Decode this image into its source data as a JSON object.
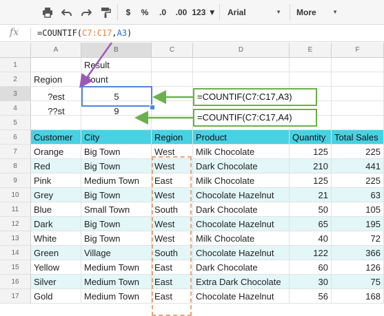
{
  "toolbar": {
    "currency_label": "$",
    "percent_label": "%",
    "dec_decrease_label": ".0",
    "dec_increase_label": ".00",
    "number_format_label": "123",
    "font_name": "Arial",
    "more_label": "More"
  },
  "formula_bar": {
    "fx_label": "fx",
    "prefix": "=COUNTIF(",
    "ref1": "C7:C17",
    "comma": ",",
    "ref2": "A3",
    "suffix": ")"
  },
  "columns": [
    "A",
    "B",
    "C",
    "D",
    "E",
    "F"
  ],
  "rows": [
    "1",
    "2",
    "3",
    "4",
    "5",
    "6",
    "7",
    "8",
    "9",
    "10",
    "11",
    "12",
    "13",
    "14",
    "15",
    "16",
    "17"
  ],
  "summary": {
    "result_label": "Result",
    "region_label": "Region",
    "count_label": "Count",
    "criteria": [
      {
        "pattern": "?est",
        "count": "5"
      },
      {
        "pattern": "??st",
        "count": "9"
      }
    ]
  },
  "callouts": [
    "=COUNTIF(C7:C17,A3)",
    "=COUNTIF(C7:C17,A4)"
  ],
  "table": {
    "headers": [
      "Customer",
      "City",
      "Region",
      "Product",
      "Quantity",
      "Total Sales"
    ],
    "rows": [
      [
        "Orange",
        "Big Town",
        "West",
        "Milk Chocolate",
        "125",
        "225"
      ],
      [
        "Red",
        "Big Town",
        "West",
        "Dark Chocolate",
        "210",
        "441"
      ],
      [
        "Pink",
        "Medium Town",
        "East",
        "Milk Chocolate",
        "125",
        "225"
      ],
      [
        "Grey",
        "Big Town",
        "West",
        "Chocolate Hazelnut",
        "21",
        "63"
      ],
      [
        "Blue",
        "Small Town",
        "South",
        "Dark Chocolate",
        "50",
        "105"
      ],
      [
        "Dark",
        "Big Town",
        "West",
        "Chocolate Hazelnut",
        "65",
        "195"
      ],
      [
        "White",
        "Big Town",
        "West",
        "Milk Chocolate",
        "40",
        "72"
      ],
      [
        "Green",
        "Village",
        "South",
        "Chocolate Hazelnut",
        "122",
        "366"
      ],
      [
        "Yellow",
        "Medium Town",
        "East",
        "Dark Chocolate",
        "60",
        "126"
      ],
      [
        "Silver",
        "Medium Town",
        "East",
        "Extra Dark Chocolate",
        "30",
        "75"
      ],
      [
        "Gold",
        "Medium Town",
        "East",
        "Chocolate Hazelnut",
        "56",
        "168"
      ]
    ]
  },
  "colors": {
    "header_fill": "#48d1e3",
    "stripe_fill": "#e3f6f8",
    "callout_border": "#6ab04c",
    "arrow_purple": "#9b59b6",
    "dashed_range": "#e8a27d",
    "selection": "#4a86e8"
  },
  "icons": [
    "print-icon",
    "undo-icon",
    "redo-icon",
    "paint-format-icon"
  ]
}
